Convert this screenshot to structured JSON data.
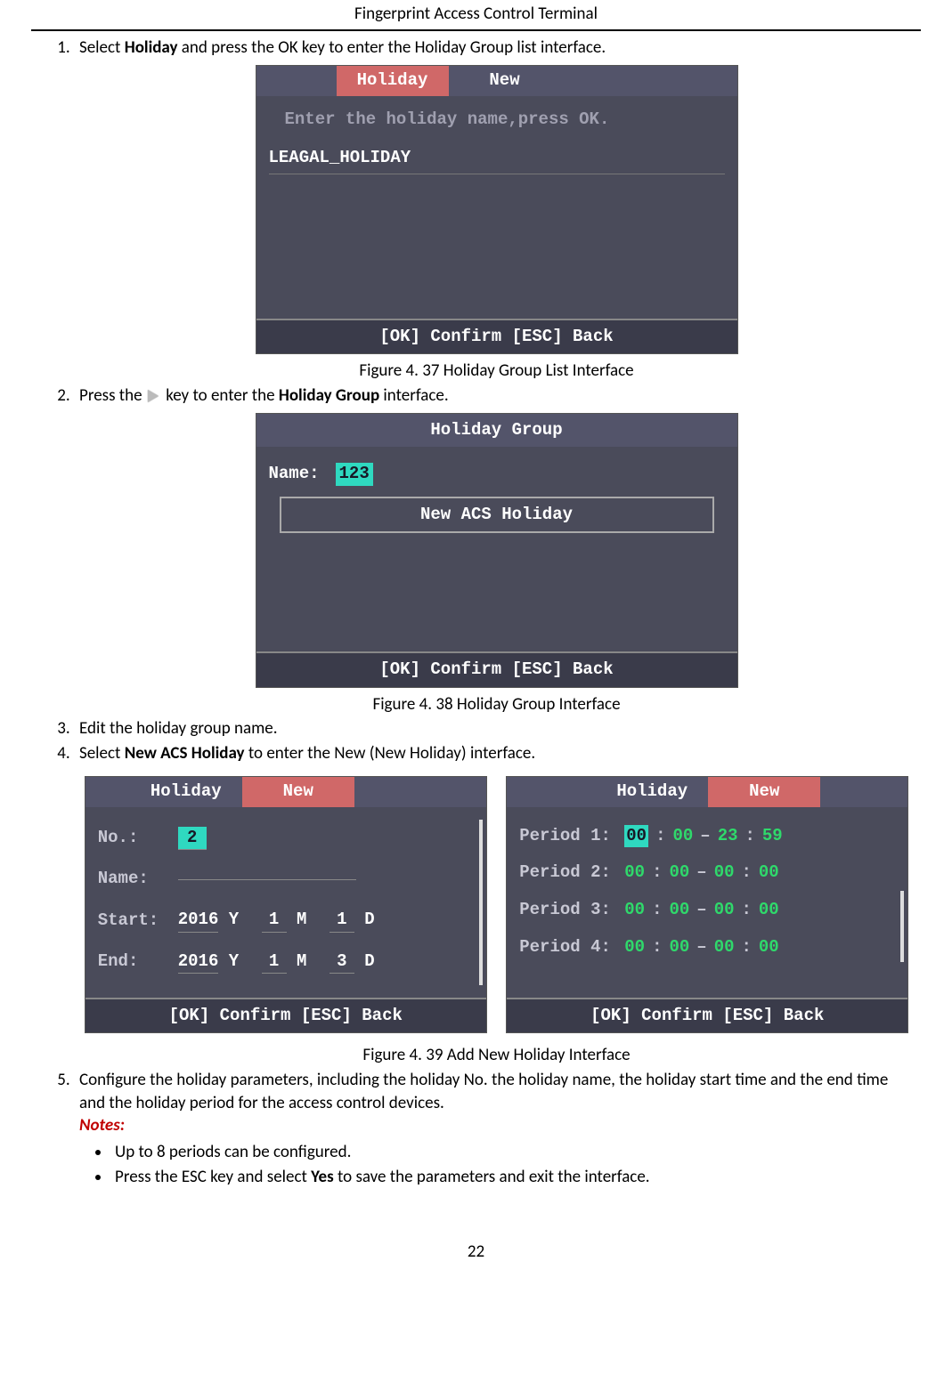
{
  "header": {
    "title": "Fingerprint Access Control Terminal"
  },
  "steps": {
    "s1_a": "Select ",
    "s1_b": "Holiday",
    "s1_c": " and press the OK key to enter the Holiday Group list interface.",
    "s2_a": "Press the",
    "s2_b": "key to enter the ",
    "s2_c": "Holiday Group",
    "s2_d": " interface.",
    "s3": "Edit the holiday group name.",
    "s4_a": "Select ",
    "s4_b": "New ACS Holiday",
    "s4_c": " to enter the New (New Holiday) interface.",
    "s5": "Configure the holiday parameters, including the holiday No. the holiday name, the holiday start time and the end time and the holiday period for the access control devices."
  },
  "figures": {
    "f37": "Figure 4. 37 Holiday Group List Interface",
    "f38": "Figure 4. 38 Holiday Group Interface",
    "f39": "Figure 4. 39 Add New Holiday Interface"
  },
  "term1": {
    "tab_active": "Holiday",
    "tab_other": "New",
    "instruction": "Enter the holiday name,press OK.",
    "item": "LEAGAL_HOLIDAY",
    "footer": "[OK] Confirm   [ESC] Back"
  },
  "term2": {
    "title": "Holiday Group",
    "name_label": "Name:",
    "name_value": "123",
    "button": "New ACS Holiday",
    "footer": "[OK] Confirm   [ESC] Back"
  },
  "term3": {
    "tab_holiday": "Holiday",
    "tab_new": "New",
    "no_label": "No.:",
    "no_value": "2",
    "name_label": "Name:",
    "start_label": "Start:",
    "end_label": "End:",
    "start": {
      "y": "2016",
      "yl": "Y",
      "m": "1",
      "ml": "M",
      "d": "1",
      "dl": "D"
    },
    "end": {
      "y": "2016",
      "yl": "Y",
      "m": "1",
      "ml": "M",
      "d": "3",
      "dl": "D"
    },
    "footer": "[OK] Confirm   [ESC] Back"
  },
  "term4": {
    "tab_holiday": "Holiday",
    "tab_new": "New",
    "p1_label": "Period 1:",
    "p2_label": "Period 2:",
    "p3_label": "Period 3:",
    "p4_label": "Period 4:",
    "p1": {
      "sh": "00",
      "sm": "00",
      "eh": "23",
      "em": "59"
    },
    "p2": {
      "sh": "00",
      "sm": "00",
      "eh": "00",
      "em": "00"
    },
    "p3": {
      "sh": "00",
      "sm": "00",
      "eh": "00",
      "em": "00"
    },
    "p4": {
      "sh": "00",
      "sm": "00",
      "eh": "00",
      "em": "00"
    },
    "footer": "[OK] Confirm   [ESC] Back"
  },
  "notes": {
    "label": "Notes:",
    "n1": "Up to 8 periods can be configured.",
    "n2_a": "Press the ESC key and select ",
    "n2_b": "Yes",
    "n2_c": " to save the parameters and exit the interface."
  },
  "page_number": "22"
}
